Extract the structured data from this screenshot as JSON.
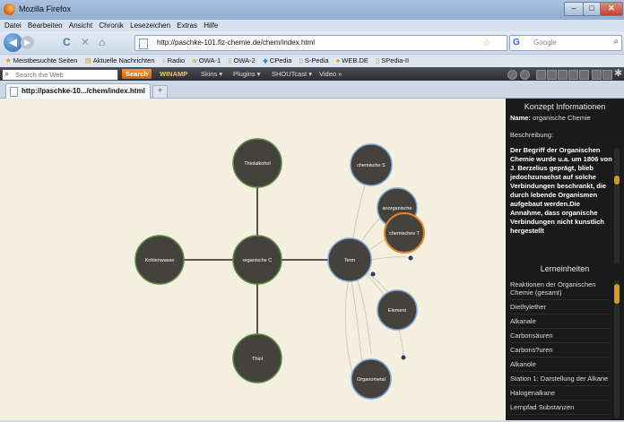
{
  "window": {
    "title": "Mozilla Firefox",
    "min": "–",
    "max": "□",
    "close": "✕"
  },
  "menu": [
    "Datei",
    "Bearbeiten",
    "Ansicht",
    "Chronik",
    "Lesezeichen",
    "Extras",
    "Hilfe"
  ],
  "nav": {
    "back_icon": "◀",
    "forward_icon": "▶",
    "reload_icon": "C",
    "stop_icon": "✕",
    "home_icon": "⌂",
    "url": "http://paschke-101.fiz-chemie.de/chem/index.html",
    "bookmark_star": "☆",
    "search_engine": "G",
    "search_placeholder": "Google",
    "search_icon": "⌕"
  },
  "bookmarks": [
    "Meistbesuchte Seiten",
    "Aktuelle Nachrichten",
    "Radio",
    "OWA-1",
    "OWA-2",
    "CPedia",
    "S-Pedia",
    "WEB.DE",
    "SPedia-II"
  ],
  "toolbar": {
    "search_placeholder": "Search the Web",
    "search_button": "Search",
    "winamp": "WINAMP",
    "items": [
      "Skins ▾",
      "Plugins ▾",
      "SHOUTcast ▾",
      "Video »"
    ]
  },
  "tabs": [
    {
      "label": "http://paschke-10.../chem/index.html"
    }
  ],
  "new_tab": "+",
  "graph": {
    "nodes": {
      "thiolalkohol": "Thiolalkohol",
      "kohlenwasse": "Kohlenwasse",
      "organische": "organische C",
      "thiol": "Thiol",
      "term": "Term",
      "chemische_s": "chemische S",
      "anorganische": "anorganische",
      "chemisches": "chemisches T",
      "element": "Element",
      "organometal": "Organometal"
    }
  },
  "panel": {
    "concept_header": "Konzept Informationen",
    "name_label": "Name:",
    "name_value": "organische Chemie",
    "desc_label": "Beschreibung:",
    "description": "Der Begriff der Organischen Chemie wurde u.a. um 1806 von J. Berzelius geprägt, blieb jedochzunachst auf solche Verbindungen beschrankt, die durch lebende Organismen aufgebaut werden.Die Annahme, dass organische Verbindungen nicht kunstlich hergestellt",
    "units_header": "Lerneinheiten",
    "units": [
      "Reaktionen der Organischen Chemie (gesamt)",
      "Diethylether",
      "Alkanale",
      "Carbonsäuren",
      "Carbons?uren",
      "Alkanole",
      "Station 1: Darstellung der Alkane",
      "Halogenalkane",
      "Lernpfad Substanzen"
    ]
  }
}
